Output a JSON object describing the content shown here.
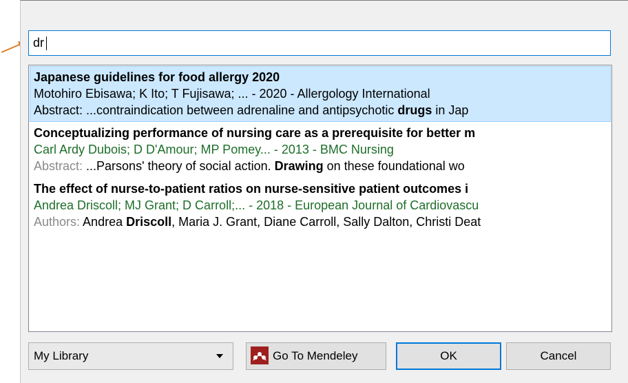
{
  "search": {
    "value": "dr"
  },
  "results": [
    {
      "title": "Japanese guidelines for food allergy 2020",
      "meta": "Motohiro Ebisawa; K Ito; T Fujisawa; ... - 2020 - Allergology International",
      "label": "Abstract:",
      "extra_before": " ...contraindication between adrenaline and antipsychotic ",
      "extra_bold": "drugs",
      "extra_after": " in Jap",
      "selected": true
    },
    {
      "title": "Conceptualizing performance of nursing care as a prerequisite for better m",
      "meta": "Carl Ardy Dubois; D D'Amour; MP Pomey... - 2013 - BMC Nursing",
      "label": "Abstract:",
      "extra_before": " ...Parsons' theory of social action. ",
      "extra_bold": "Drawing",
      "extra_after": " on these foundational wo",
      "selected": false
    },
    {
      "title": "The effect of nurse-to-patient ratios on nurse-sensitive patient outcomes i",
      "meta": "Andrea Driscoll; MJ Grant; D Carroll;... - 2018 - European Journal of Cardiovascu",
      "label": "Authors:",
      "extra_before": " Andrea ",
      "extra_bold": "Driscoll",
      "extra_after": ", Maria J. Grant, Diane Carroll, Sally Dalton, Christi Deat",
      "selected": false
    }
  ],
  "library_select": {
    "value": "My Library"
  },
  "buttons": {
    "go_to_mendeley": "Go To Mendeley",
    "ok": "OK",
    "cancel": "Cancel"
  },
  "colors": {
    "selection_bg": "#cce8ff",
    "focus_border": "#0078d7",
    "meta_green": "#1e6e2a",
    "arrow_orange": "#e07b24",
    "mendeley_red": "#9f1f1f"
  }
}
